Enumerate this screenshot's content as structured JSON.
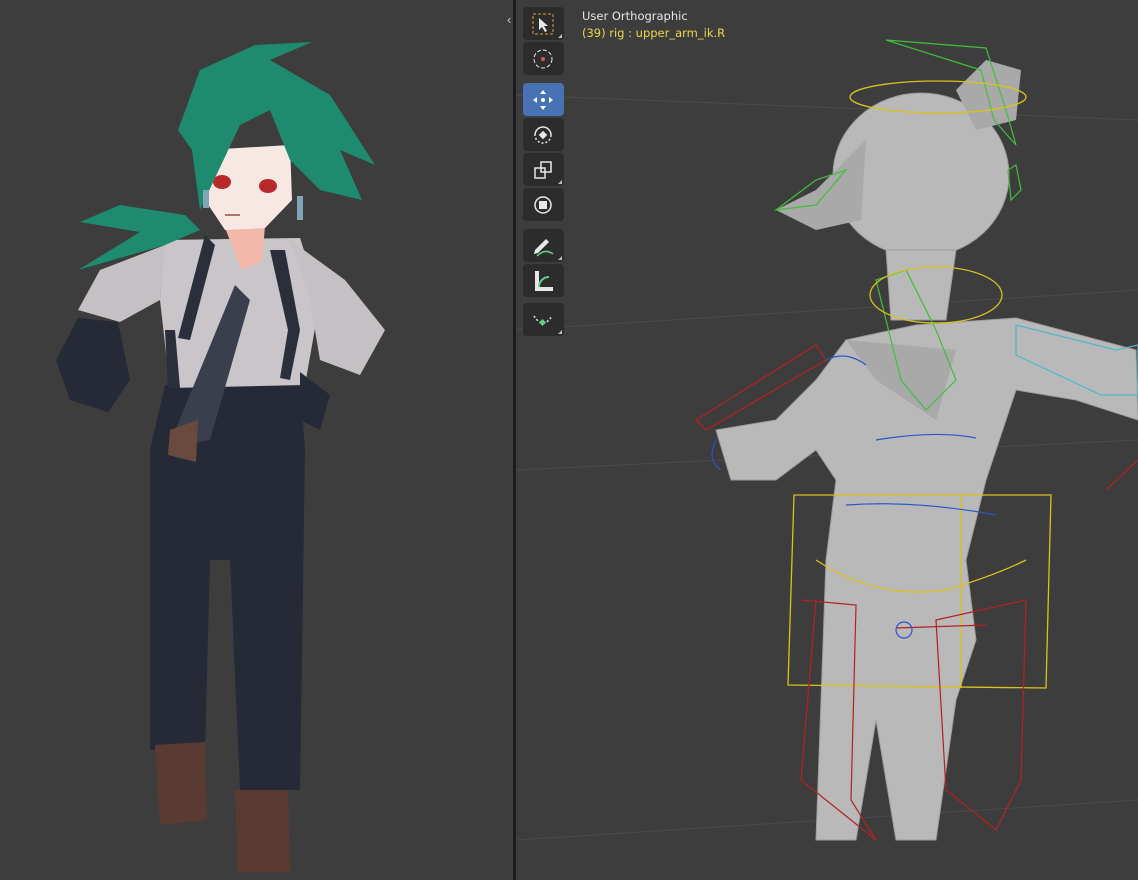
{
  "viewport": {
    "view_name": "User Orthographic",
    "active_info": "(39) rig : upper_arm_ik.R"
  },
  "toolbar": {
    "tools": [
      {
        "name": "select-box",
        "active": false
      },
      {
        "name": "cursor",
        "active": false
      },
      {
        "name": "move",
        "active": true
      },
      {
        "name": "rotate",
        "active": false
      },
      {
        "name": "scale",
        "active": false
      },
      {
        "name": "transform",
        "active": false
      },
      {
        "name": "annotate",
        "active": false
      },
      {
        "name": "measure",
        "active": false
      },
      {
        "name": "roll",
        "active": false
      }
    ]
  },
  "colors": {
    "viewport_bg": "#3d3d3d",
    "active_tool": "#4772b3",
    "tool_bg": "#2c2c2c",
    "info_text": "#e8d84a",
    "hair": "#1e8a6e",
    "shirt": "#c4c0c4",
    "pants": "#262a36",
    "boots": "#5a3b33",
    "model_gray": "#b9b9b9",
    "bone_green": "#3fbf3a",
    "bone_yellow": "#d9c21c",
    "bone_red": "#b32222",
    "bone_blue": "#2a55c9",
    "bone_cyan": "#4fb6c9"
  }
}
